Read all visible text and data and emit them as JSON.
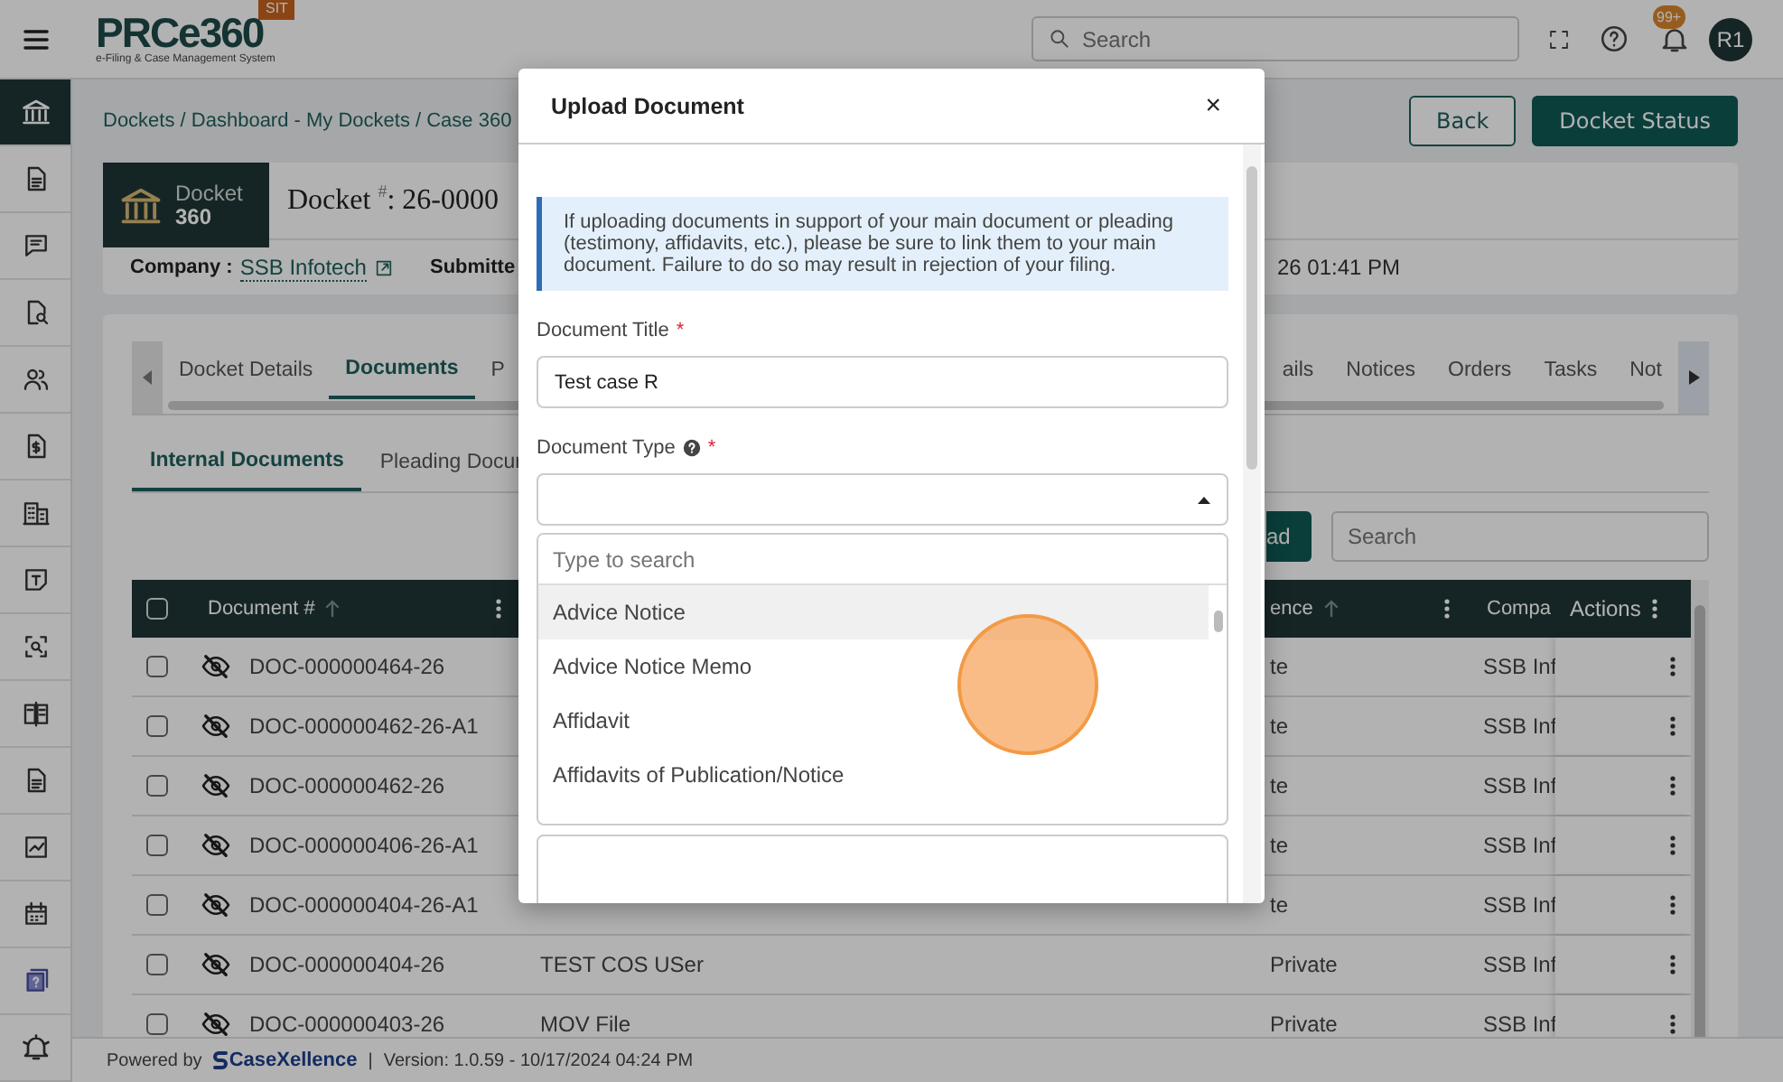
{
  "header": {
    "logo": "PRCe360",
    "tagline": "e-Filing & Case Management System",
    "environment": "SIT",
    "search": {
      "placeholder": "Search"
    },
    "notifications": "99+",
    "avatar": "R1"
  },
  "sidebar": {
    "items": [
      {
        "selected": true
      },
      {
        "selected": false
      },
      {
        "selected": false
      },
      {
        "selected": false
      },
      {
        "selected": false
      },
      {
        "selected": false
      },
      {
        "selected": false
      },
      {
        "selected": false
      },
      {
        "selected": false
      },
      {
        "selected": false
      },
      {
        "selected": false
      },
      {
        "selected": false
      },
      {
        "selected": false
      },
      {
        "selected": false
      },
      {
        "selected": false
      }
    ]
  },
  "breadcrumb": "Dockets / Dashboard - My Dockets / Case 360",
  "buttons": [
    {
      "label": "Back",
      "kind": "outline"
    },
    {
      "label": "Docket Status",
      "kind": "primary"
    }
  ],
  "docket": {
    "brand": "Docket",
    "brand_number": "360",
    "title": "Docket $^{#}$: 26-0000",
    "company_label": "Company :",
    "company": "SSB Infotech",
    "submitted_label": "Submitte",
    "submitted_value": "26 01:41 PM"
  },
  "tabs": [
    {
      "label": "Docket Details",
      "selected": false
    },
    {
      "label": "Documents",
      "selected": true
    },
    {
      "label": "P",
      "selected": false
    },
    {
      "label": "ails",
      "selected": false
    },
    {
      "label": "Notices",
      "selected": false
    },
    {
      "label": "Orders",
      "selected": false
    },
    {
      "label": "Tasks",
      "selected": false
    },
    {
      "label": "Not",
      "selected": false
    }
  ],
  "subtabs": [
    {
      "label": "Internal Documents",
      "selected": true
    },
    {
      "label": "Pleading Docur",
      "selected": false
    }
  ],
  "upload_button": "ad",
  "table_search": {
    "placeholder": "Search"
  },
  "table": {
    "select_all": {
      "checked": false
    },
    "columns": [
      {
        "label": "Document #",
        "kind": "sortable"
      },
      {
        "label": "ence",
        "kind": "sortable"
      },
      {
        "label": "Compa",
        "kind": "plain"
      },
      {
        "label": "Actions",
        "kind": "plain"
      }
    ],
    "rows": [
      {
        "checked": false,
        "document": "DOC-000000464-26",
        "visibility": "te",
        "company": "SSB Inf"
      },
      {
        "checked": false,
        "document": "DOC-000000462-26-A1",
        "visibility": "te",
        "company": "SSB Inf"
      },
      {
        "checked": false,
        "document": "DOC-000000462-26",
        "visibility": "te",
        "company": "SSB Inf"
      },
      {
        "checked": false,
        "document": "DOC-000000406-26-A1",
        "visibility": "te",
        "company": "SSB Inf"
      },
      {
        "checked": false,
        "document": "DOC-000000404-26-A1",
        "visibility": "te",
        "company": "SSB Inf"
      },
      {
        "checked": false,
        "document": "DOC-000000404-26",
        "title": "TEST COS USer",
        "visibility": "Private",
        "company": "SSB Inf"
      },
      {
        "checked": false,
        "document": "DOC-000000403-26",
        "title": "MOV File",
        "visibility": "Private",
        "company": "SSB Inf"
      }
    ]
  },
  "footer": {
    "powered_by": "Powered by",
    "brand": "CaseXellence",
    "separator": "|",
    "version": "Version: 1.0.59 - 10/17/2024 04:24 PM"
  },
  "modal": {
    "title": "Upload Document",
    "close": "×",
    "notice": "If uploading documents in support of your main document or pleading (testimony, affidavits, etc.), please be sure to link them to your main document. Failure to do so may result in rejection of your filing.",
    "fields": [
      {
        "label": "Document Title",
        "required_mark": "*",
        "value": "Test case R"
      },
      {
        "label": "Document Type",
        "required_mark": "*",
        "help": true
      }
    ],
    "dropdown": {
      "placeholder": "Type to search",
      "options": [
        {
          "label": "Advice Notice",
          "highlighted": true
        },
        {
          "label": "Advice Notice Memo",
          "highlighted": false
        },
        {
          "label": "Affidavit",
          "highlighted": false
        },
        {
          "label": "Affidavits of Publication/Notice",
          "highlighted": false
        }
      ]
    }
  }
}
